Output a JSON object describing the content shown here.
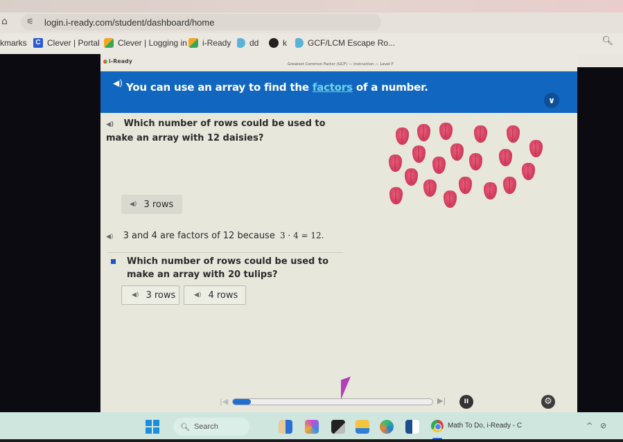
{
  "browser": {
    "url": "login.i-ready.com/student/dashboard/home",
    "home_icon": "home-icon",
    "site_info_icon": "site-settings-icon",
    "zoom_icon": "zoom-magnifier-icon",
    "bookmarks": [
      {
        "label": "kmarks",
        "icon": "none"
      },
      {
        "label": "Clever | Portal",
        "icon": "clever-icon"
      },
      {
        "label": "Clever | Logging in",
        "icon": "cube-icon"
      },
      {
        "label": "i-Ready",
        "icon": "cube-icon"
      },
      {
        "label": "dd",
        "icon": "p-icon"
      },
      {
        "label": "k",
        "icon": "globe-icon"
      },
      {
        "label": "GCF/LCM Escape Ro...",
        "icon": "p-icon"
      }
    ]
  },
  "lesson": {
    "logo": "i-Ready",
    "title": "Greatest Common Factor (GCF) — Instruction — Level F",
    "close_label": "×",
    "banner": {
      "before": "You can use an array to find the ",
      "link": "factors",
      "after": " of a number.",
      "chevron": "⌄"
    },
    "question1": "Which number of rows could be used to make an array with 12 daisies?",
    "answer1": "3 rows",
    "explanation": "3 and 4 are factors of 12 because",
    "explanation_math": "3 · 4 = 12.",
    "question2": "Which number of rows could be used to make an array with 20 tulips?",
    "choices": [
      "3 rows",
      "4 rows"
    ],
    "tulip_count": 20,
    "speaker_glyph": "◀))"
  },
  "player": {
    "progress": 0.09,
    "prev": "|◀",
    "next": "▶|",
    "pause": "II",
    "settings": "⚙"
  },
  "taskbar": {
    "search_placeholder": "Search",
    "search_icon": "search-icon",
    "active_app_label": "Math To Do, i-Ready - C",
    "tray": [
      "^",
      "⊘"
    ]
  }
}
